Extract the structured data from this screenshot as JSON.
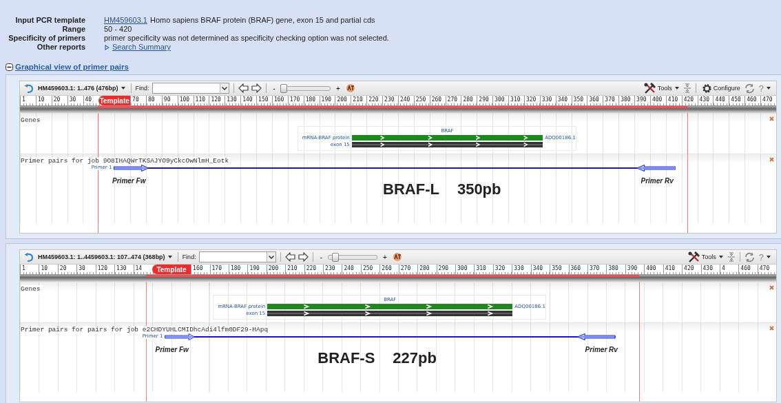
{
  "summary": [
    {
      "kind": "link_text",
      "label": "Input PCR template",
      "link": "HM459603.1",
      "text": "Homo sapiens BRAF protein (BRAF) gene, exon 15 and partial cds"
    },
    {
      "kind": "text",
      "label": "Range",
      "text": "50 - 420"
    },
    {
      "kind": "text",
      "label": "Specificity of primers",
      "text": "primer specificity was not determined as specificity checking option was not selected."
    },
    {
      "kind": "report_link",
      "label": "Other reports",
      "link": "Search Summary"
    }
  ],
  "section": {
    "title": "Graphical view of primer pairs",
    "expanded": true
  },
  "viewers": [
    {
      "title": "HM459603.1: 1..476 (476bp)",
      "find_label": "Find:",
      "zoom_out": "-",
      "zoom_in": "+",
      "zoom": {
        "level": 0.05
      },
      "tools": [
        {
          "kind": "tools",
          "label": "Tools"
        },
        {
          "kind": "fit"
        },
        {
          "kind": "configure",
          "label": "Configure"
        },
        {
          "kind": "refresh"
        },
        {
          "kind": "help",
          "label": "?"
        }
      ],
      "ruler": [
        {
          "kind": "tick",
          "label": "1"
        },
        {
          "kind": "tick",
          "label": "10"
        },
        {
          "kind": "tick",
          "label": "20"
        },
        {
          "kind": "tick",
          "label": "30"
        },
        {
          "kind": "tick",
          "label": "40"
        },
        {
          "kind": "template",
          "label": "Template"
        },
        {
          "kind": "tick",
          "label": "70"
        },
        {
          "kind": "tick",
          "label": "80"
        },
        {
          "kind": "tick",
          "label": "90"
        },
        {
          "kind": "tick",
          "label": "100"
        },
        {
          "kind": "tick",
          "label": "110"
        },
        {
          "kind": "tick",
          "label": "120"
        },
        {
          "kind": "tick",
          "label": "130"
        },
        {
          "kind": "tick",
          "label": "140"
        },
        {
          "kind": "tick",
          "label": "150"
        },
        {
          "kind": "tick",
          "label": "160"
        },
        {
          "kind": "tick",
          "label": "170"
        },
        {
          "kind": "tick",
          "label": "180"
        },
        {
          "kind": "tick",
          "label": "190"
        },
        {
          "kind": "tick",
          "label": "200"
        },
        {
          "kind": "tick",
          "label": "210"
        },
        {
          "kind": "tick",
          "label": "220"
        },
        {
          "kind": "tick",
          "label": "230"
        },
        {
          "kind": "tick",
          "label": "240"
        },
        {
          "kind": "tick",
          "label": "250"
        },
        {
          "kind": "tick",
          "label": "260"
        },
        {
          "kind": "tick",
          "label": "270"
        },
        {
          "kind": "tick",
          "label": "280"
        },
        {
          "kind": "tick",
          "label": "290"
        },
        {
          "kind": "tick",
          "label": "300"
        },
        {
          "kind": "tick",
          "label": "310"
        },
        {
          "kind": "tick",
          "label": "320"
        },
        {
          "kind": "tick",
          "label": "330"
        },
        {
          "kind": "tick",
          "label": "340"
        },
        {
          "kind": "tick",
          "label": "350"
        },
        {
          "kind": "tick",
          "label": "360"
        },
        {
          "kind": "tick",
          "label": "370"
        },
        {
          "kind": "tick",
          "label": "380"
        },
        {
          "kind": "tick",
          "label": "390"
        },
        {
          "kind": "tick",
          "label": "400"
        },
        {
          "kind": "tick",
          "label": "410"
        },
        {
          "kind": "tick",
          "label": "420"
        },
        {
          "kind": "tick",
          "label": "430"
        },
        {
          "kind": "tick",
          "label": "440"
        },
        {
          "kind": "tick",
          "label": "450"
        },
        {
          "kind": "tick",
          "label": "460"
        },
        {
          "kind": "tick",
          "label": "470"
        }
      ],
      "tracks": [
        {
          "kind": "genes",
          "title": "Genes",
          "gene": {
            "name": "BRAF",
            "mrna_label": "mRNA-BRAF protein",
            "exon_label": "exon 15",
            "accession": "ADQ00186.1"
          }
        },
        {
          "kind": "primers",
          "title": "Primer pairs for job 9O8IHAQWrTKSAJYO9yCkcOwNlmH_Eotk",
          "primer": {
            "label": "Primer 1"
          },
          "annotations": [
            {
              "kind": "primer_label",
              "text": "Primer Fw"
            },
            {
              "kind": "primer_label",
              "text": "Primer Rv"
            },
            {
              "kind": "product",
              "name": "BRAF-L",
              "size": "350pb"
            }
          ]
        }
      ]
    },
    {
      "title": "HM459603.1: 1..4459603.1: 107..474 (368bp)",
      "find_label": "Find:",
      "zoom_out": "-",
      "zoom_in": "+",
      "zoom": {
        "level": 0.15
      },
      "tools": [
        {
          "kind": "tools",
          "label": "Tools"
        },
        {
          "kind": "fit"
        },
        {
          "kind": "refresh"
        },
        {
          "kind": "help",
          "label": "?"
        }
      ],
      "ruler": [
        {
          "kind": "tick",
          "label": "1"
        },
        {
          "kind": "tick",
          "label": "10"
        },
        {
          "kind": "tick",
          "label": "20"
        },
        {
          "kind": "tick",
          "label": "30"
        },
        {
          "kind": "tick",
          "label": "120"
        },
        {
          "kind": "tick",
          "label": "130"
        },
        {
          "kind": "tick",
          "label": "14"
        },
        {
          "kind": "template",
          "label": "Template"
        },
        {
          "kind": "tick",
          "label": "160"
        },
        {
          "kind": "tick",
          "label": "170"
        },
        {
          "kind": "tick",
          "label": "180"
        },
        {
          "kind": "tick",
          "label": "190"
        },
        {
          "kind": "tick",
          "label": "200"
        },
        {
          "kind": "tick",
          "label": "210"
        },
        {
          "kind": "tick",
          "label": "220"
        },
        {
          "kind": "tick",
          "label": "230"
        },
        {
          "kind": "tick",
          "label": "240"
        },
        {
          "kind": "tick",
          "label": "250"
        },
        {
          "kind": "tick",
          "label": "260"
        },
        {
          "kind": "tick",
          "label": "270"
        },
        {
          "kind": "tick",
          "label": "280"
        },
        {
          "kind": "tick",
          "label": "290"
        },
        {
          "kind": "tick",
          "label": "300"
        },
        {
          "kind": "tick",
          "label": "310"
        },
        {
          "kind": "tick",
          "label": "320"
        },
        {
          "kind": "tick",
          "label": "330"
        },
        {
          "kind": "tick",
          "label": "340"
        },
        {
          "kind": "tick",
          "label": "350"
        },
        {
          "kind": "tick",
          "label": "360"
        },
        {
          "kind": "tick",
          "label": "370"
        },
        {
          "kind": "tick",
          "label": "380"
        },
        {
          "kind": "tick",
          "label": "390"
        },
        {
          "kind": "tick",
          "label": "400"
        },
        {
          "kind": "tick",
          "label": "410"
        },
        {
          "kind": "tick",
          "label": "420"
        },
        {
          "kind": "tick",
          "label": "430"
        },
        {
          "kind": "tick",
          "label": "4"
        },
        {
          "kind": "tick",
          "label": "460"
        },
        {
          "kind": "tick",
          "label": "470"
        }
      ],
      "tracks": [
        {
          "kind": "genes",
          "title": "Genes",
          "gene": {
            "name": "BRAF",
            "mrna_label": "mRNA-BRAF protein",
            "exon_label": "exon 15",
            "accession": "ADQ00186.1"
          }
        },
        {
          "kind": "primers",
          "title": "Primer pairs for pairs for job e2CHDYUHLCMIDhcAdi4lfm0DF29-HApq",
          "primer": {
            "label": "Primer 1"
          },
          "annotations": [
            {
              "kind": "primer_label",
              "text": "Primer Fw"
            },
            {
              "kind": "primer_label",
              "text": "Primer Rv"
            },
            {
              "kind": "product",
              "name": "BRAF-S",
              "size": "227pb"
            }
          ]
        }
      ]
    }
  ]
}
